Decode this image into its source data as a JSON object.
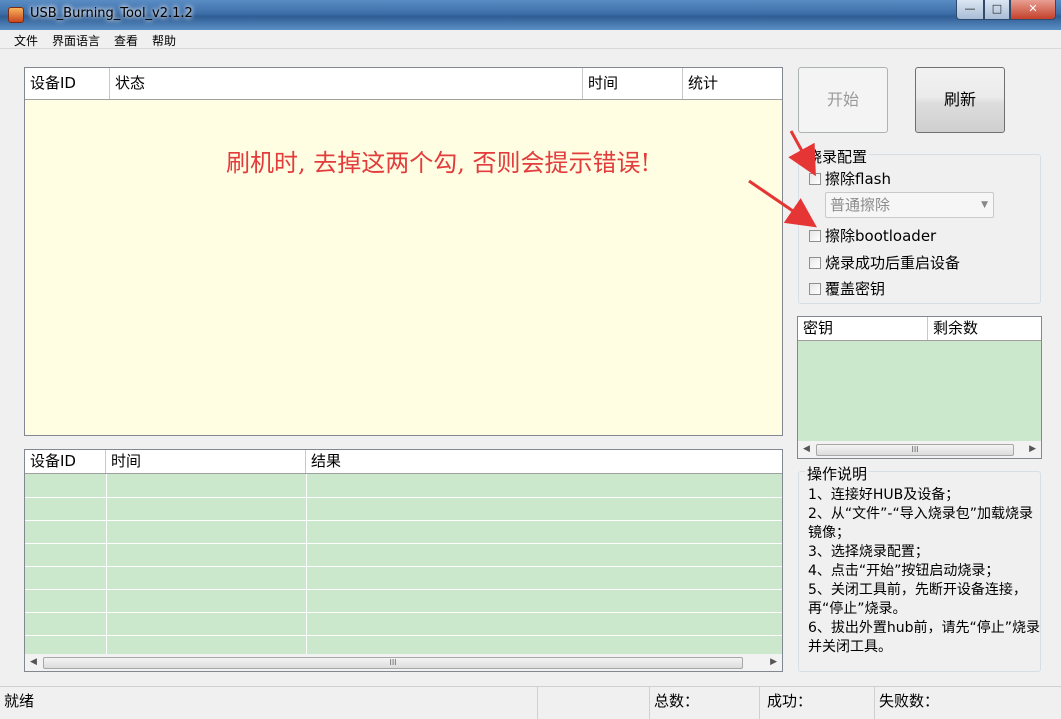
{
  "window": {
    "title": "USB_Burning_Tool_v2.1.2",
    "minimize_glyph": "—",
    "maximize_glyph": "□",
    "close_glyph": "✕"
  },
  "menu": [
    "文件",
    "界面语言",
    "查看",
    "帮助"
  ],
  "device_table": {
    "columns": [
      "设备ID",
      "状态",
      "时间",
      "统计"
    ],
    "annotation": "刷机时, 去掉这两个勾, 否则会提示错误!"
  },
  "result_table": {
    "columns": [
      "设备ID",
      "时间",
      "结果"
    ],
    "scroll_glyph": "III"
  },
  "buttons": {
    "start": "开始",
    "refresh": "刷新"
  },
  "burn_config": {
    "title": "烧录配置",
    "erase_flash": "擦除flash",
    "erase_mode": "普通擦除",
    "erase_bootloader": "擦除bootloader",
    "reboot_after": "烧录成功后重启设备",
    "overwrite_key": "覆盖密钥"
  },
  "key_table": {
    "columns": [
      "密钥",
      "剩余数"
    ],
    "scroll_glyph": "III"
  },
  "instructions": {
    "title": "操作说明",
    "steps": [
      "1、连接好HUB及设备；",
      "2、从“文件”-“导入烧录包”加载烧录镜像；",
      "3、选择烧录配置；",
      "4、点击“开始”按钮启动烧录；",
      "5、关闭工具前，先断开设备连接，再“停止”烧录。",
      "6、拔出外置hub前，请先“停止”烧录并关闭工具。"
    ]
  },
  "status": {
    "state": "就绪",
    "total": "总数：",
    "success": "成功：",
    "fail": "失败数："
  },
  "colors": {
    "device_grid_bg": "#fffde2",
    "green_grid_bg": "#cce8cc",
    "annotation": "#e23c3c"
  }
}
